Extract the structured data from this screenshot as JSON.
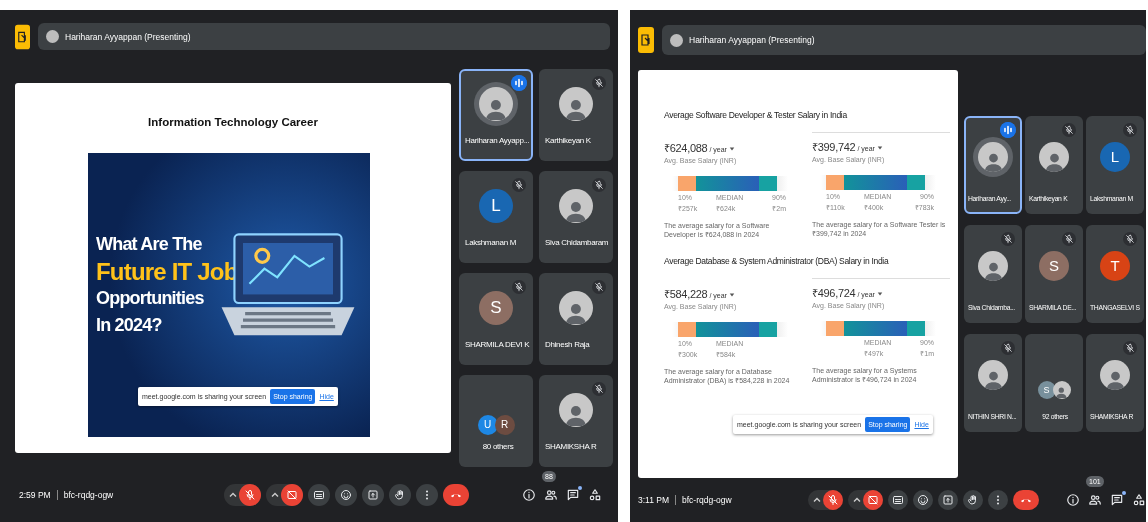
{
  "screens": [
    {
      "presenter_bar": {
        "label": "Hariharan Ayyappan (Presenting)"
      },
      "slide": {
        "kind": "poster",
        "title": "Information Technology Career",
        "poster_lines": [
          {
            "text": "What Are The",
            "highlight": false
          },
          {
            "text": "Future IT Job",
            "highlight": true
          },
          {
            "text": "Opportunities",
            "highlight": false
          },
          {
            "text": "In 2024?",
            "highlight": false
          }
        ]
      },
      "share_notice": {
        "text": "meet.google.com is sharing your screen",
        "stop": "Stop sharing",
        "hide": "Hide"
      },
      "tiles": [
        {
          "name": "Hariharan Ayyapp...",
          "speaking": true,
          "muted": false,
          "avatars": [
            {
              "kind": "photo"
            }
          ]
        },
        {
          "name": "Karthikeyan K",
          "speaking": false,
          "muted": true,
          "avatars": [
            {
              "kind": "photo"
            }
          ]
        },
        {
          "name": "Lakshmanan M",
          "speaking": false,
          "muted": true,
          "avatars": [
            {
              "kind": "letter",
              "letter": "L",
              "color": "#1967b2"
            }
          ]
        },
        {
          "name": "Siva Chidambaram",
          "speaking": false,
          "muted": true,
          "avatars": [
            {
              "kind": "photo"
            }
          ]
        },
        {
          "name": "SHARMILA DEVI K",
          "speaking": false,
          "muted": true,
          "avatars": [
            {
              "kind": "letter",
              "letter": "S",
              "color": "#8d6e63"
            }
          ]
        },
        {
          "name": "Dhinesh Raja",
          "speaking": false,
          "muted": true,
          "avatars": [
            {
              "kind": "photo"
            }
          ]
        },
        {
          "name": "80 others",
          "speaking": false,
          "muted": false,
          "avatars": [
            {
              "kind": "letter",
              "letter": "U",
              "color": "#1e88e5"
            },
            {
              "kind": "letter",
              "letter": "R",
              "color": "#6d4c41"
            }
          ]
        },
        {
          "name": "SHAMIKSHA R",
          "speaking": false,
          "muted": true,
          "avatars": [
            {
              "kind": "photo"
            }
          ]
        }
      ],
      "meeting": {
        "time": "2:59 PM",
        "code": "bfc-rqdg-ogw"
      },
      "controls": [
        {
          "kind": "mic",
          "on": false
        },
        {
          "kind": "camera",
          "on": false
        },
        {
          "kind": "captions",
          "on": true
        },
        {
          "kind": "emoji",
          "on": true
        },
        {
          "kind": "present",
          "on": true
        },
        {
          "kind": "hand",
          "on": true
        },
        {
          "kind": "more",
          "on": true
        },
        {
          "kind": "end-call"
        }
      ],
      "side_buttons": [
        {
          "kind": "info"
        },
        {
          "kind": "people",
          "badge": "88"
        },
        {
          "kind": "chat",
          "unread": true
        },
        {
          "kind": "activities"
        }
      ]
    },
    {
      "presenter_bar": {
        "label": "Hariharan Ayyappan (Presenting)"
      },
      "slide": {
        "kind": "salary-report",
        "sections": [
          {
            "title": "Average Software Developer & Tester Salary in India",
            "cards": [
              {
                "amount": "₹624,088",
                "period": "/ year",
                "subtitle": "Avg. Base Salary (INR)",
                "labels": [
                  {
                    "kind": "low",
                    "text": "10%"
                  },
                  {
                    "kind": "median",
                    "text": "MEDIAN"
                  },
                  {
                    "kind": "high",
                    "text": "90%"
                  }
                ],
                "values": [
                  {
                    "kind": "low",
                    "text": "₹257k"
                  },
                  {
                    "kind": "median",
                    "text": "₹624k"
                  },
                  {
                    "kind": "high",
                    "text": "₹2m"
                  }
                ],
                "caption": "The average salary for a Software Developer is ₹624,088 in 2024"
              },
              {
                "amount": "₹399,742",
                "period": "/ year",
                "subtitle": "Avg. Base Salary (INR)",
                "labels": [
                  {
                    "kind": "low",
                    "text": "10%"
                  },
                  {
                    "kind": "median",
                    "text": "MEDIAN"
                  },
                  {
                    "kind": "high",
                    "text": "90%"
                  }
                ],
                "values": [
                  {
                    "kind": "low",
                    "text": "₹110k"
                  },
                  {
                    "kind": "median",
                    "text": "₹400k"
                  },
                  {
                    "kind": "high",
                    "text": "₹783k"
                  }
                ],
                "caption": "The average salary for a Software Tester is ₹399,742 in 2024"
              }
            ]
          },
          {
            "title": "Average Database & System Administrator (DBA) Salary in India",
            "cards": [
              {
                "amount": "₹584,228",
                "period": "/ year",
                "subtitle": "Avg. Base Salary (INR)",
                "labels": [
                  {
                    "kind": "low",
                    "text": "10%"
                  },
                  {
                    "kind": "median",
                    "text": "MEDIAN"
                  }
                ],
                "values": [
                  {
                    "kind": "low",
                    "text": "₹300k"
                  },
                  {
                    "kind": "median",
                    "text": "₹584k"
                  }
                ],
                "caption": "The average salary for a Database Administrator (DBA) is ₹584,228 in 2024"
              },
              {
                "amount": "₹496,724",
                "period": "/ year",
                "subtitle": "Avg. Base Salary (INR)",
                "labels": [
                  {
                    "kind": "median",
                    "text": "MEDIAN"
                  },
                  {
                    "kind": "high",
                    "text": "90%"
                  }
                ],
                "values": [
                  {
                    "kind": "median",
                    "text": "₹497k"
                  },
                  {
                    "kind": "high",
                    "text": "₹1m"
                  }
                ],
                "caption": "The average salary for a Systems Administrator is ₹496,724 in 2024"
              }
            ]
          }
        ]
      },
      "share_notice": {
        "text": "meet.google.com is sharing your screen",
        "stop": "Stop sharing",
        "hide": "Hide"
      },
      "tiles": [
        {
          "name": "Hariharan Ayy...",
          "speaking": true,
          "muted": false,
          "avatars": [
            {
              "kind": "photo"
            }
          ]
        },
        {
          "name": "Karthikeyan K",
          "speaking": false,
          "muted": true,
          "avatars": [
            {
              "kind": "photo"
            }
          ]
        },
        {
          "name": "Lakshmanan M",
          "speaking": false,
          "muted": true,
          "avatars": [
            {
              "kind": "letter",
              "letter": "L",
              "color": "#1967b2"
            }
          ]
        },
        {
          "name": "Siva Chidamba...",
          "speaking": false,
          "muted": true,
          "avatars": [
            {
              "kind": "photo"
            }
          ]
        },
        {
          "name": "SHARMILA DE...",
          "speaking": false,
          "muted": true,
          "avatars": [
            {
              "kind": "letter",
              "letter": "S",
              "color": "#8d6e63"
            }
          ]
        },
        {
          "name": "THANGASELVI S",
          "speaking": false,
          "muted": true,
          "avatars": [
            {
              "kind": "letter",
              "letter": "T",
              "color": "#d84315"
            }
          ]
        },
        {
          "name": "NITHIN SHRI N...",
          "speaking": false,
          "muted": true,
          "avatars": [
            {
              "kind": "photo"
            }
          ]
        },
        {
          "name": "92 others",
          "speaking": false,
          "muted": false,
          "avatars": [
            {
              "kind": "letter",
              "letter": "S",
              "color": "#78909c"
            },
            {
              "kind": "photo"
            }
          ]
        },
        {
          "name": "SHAMIKSHA R",
          "speaking": false,
          "muted": true,
          "avatars": [
            {
              "kind": "photo"
            }
          ]
        }
      ],
      "meeting": {
        "time": "3:11 PM",
        "code": "bfc-rqdg-ogw"
      },
      "controls": [
        {
          "kind": "mic",
          "on": false
        },
        {
          "kind": "camera",
          "on": false
        },
        {
          "kind": "captions",
          "on": true
        },
        {
          "kind": "emoji",
          "on": true
        },
        {
          "kind": "present",
          "on": true
        },
        {
          "kind": "hand",
          "on": true
        },
        {
          "kind": "more",
          "on": true
        },
        {
          "kind": "end-call"
        }
      ],
      "side_buttons": [
        {
          "kind": "info"
        },
        {
          "kind": "people",
          "badge": "101"
        },
        {
          "kind": "chat",
          "unread": true
        },
        {
          "kind": "activities"
        }
      ]
    }
  ]
}
